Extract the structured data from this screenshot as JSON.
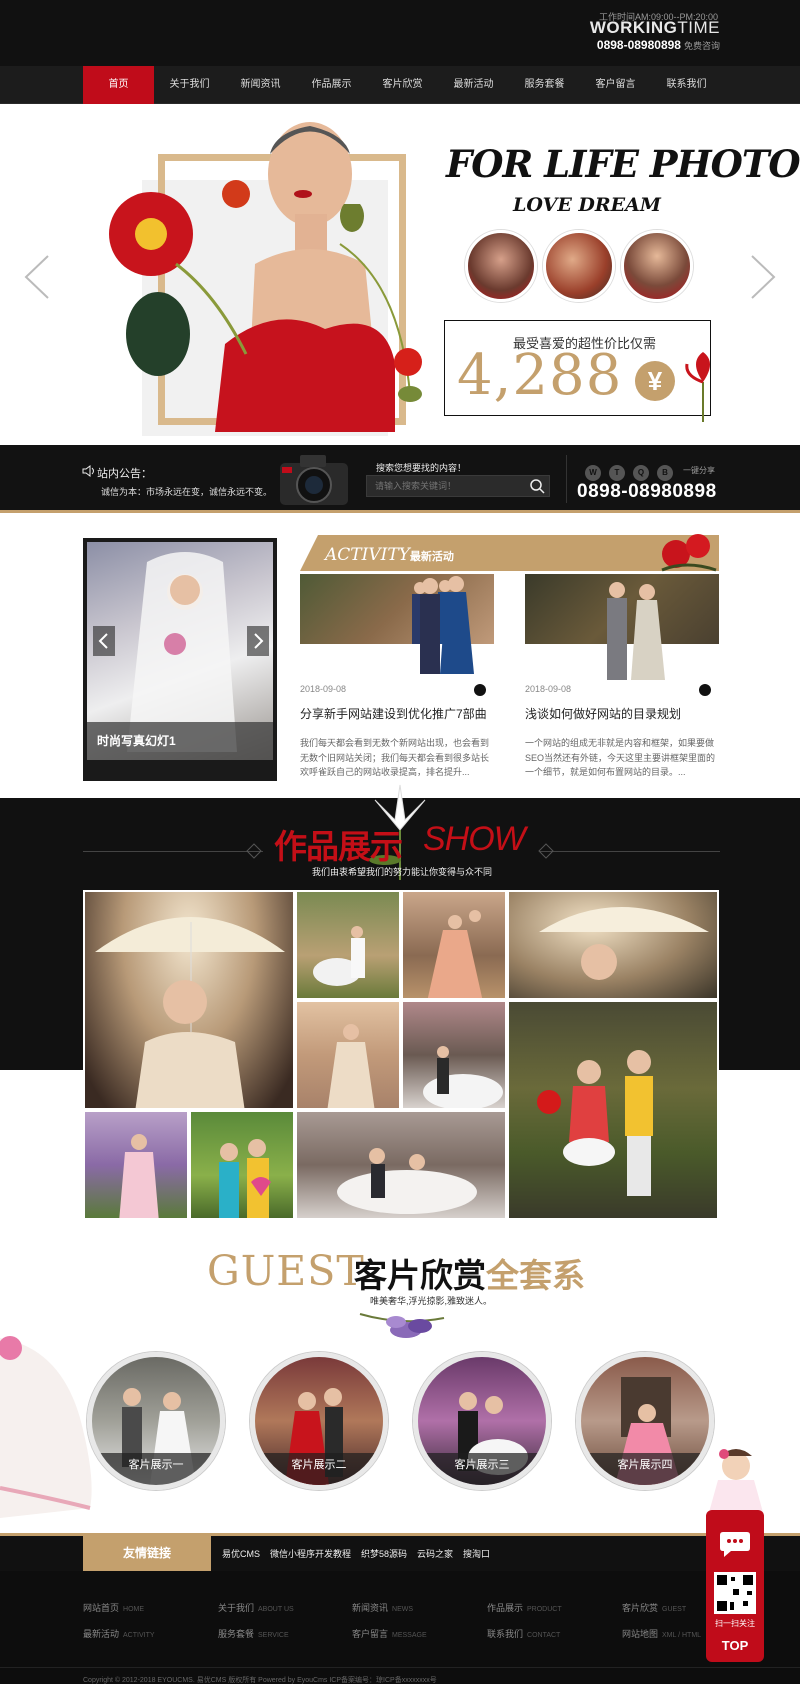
{
  "header": {
    "working_hours": "工作时间AM:09:00--PM:20:00",
    "working_title_bold": "WORKING",
    "working_title_rest": "TIME",
    "phone": "0898-08980898",
    "phone_note": "免费咨询"
  },
  "nav": {
    "items": [
      "首页",
      "关于我们",
      "新闻资讯",
      "作品展示",
      "客片欣赏",
      "最新活动",
      "服务套餐",
      "客户留言",
      "联系我们"
    ],
    "active": 0
  },
  "banner": {
    "headline": "FOR LIFE PHOTO",
    "subheadline": "LOVE DREAM",
    "price_caption": "最受喜爱的超性价比仅需",
    "price": "4,288",
    "currency": "¥"
  },
  "search_bar": {
    "notice_title": "站内公告：",
    "notice_text": "诚信为本：市场永远在变，诚信永远不变。",
    "search_title": "搜索您想要找的内容！",
    "search_placeholder": "请输入搜索关键词！",
    "share_label": "一键分享",
    "phone": "0898-08980898"
  },
  "slideshow": {
    "caption": "时尚写真幻灯1"
  },
  "activity": {
    "title_en": "ACTIVITY",
    "title_cn": "最新活动",
    "articles": [
      {
        "date": "2018-09-08",
        "title": "分享新手网站建设到优化推广7部曲",
        "desc": "我们每天都会看到无数个新网站出现，也会看到无数个旧网站关闭；我们每天都会看到很多站长欢呼雀跃自己的网站收录提高，排名提升..."
      },
      {
        "date": "2018-09-08",
        "title": "浅谈如何做好网站的目录规划",
        "desc": "一个网站的组成无非就是内容和框架，如果要做SEO当然还有外链，今天这里主要讲框架里面的一个细节，就是如何布置网站的目录。..."
      }
    ]
  },
  "works": {
    "title_cn": "作品展示",
    "title_en": "SHOW",
    "subtitle": "我们由衷希望我们的努力能让你变得与众不同"
  },
  "guest": {
    "title_en": "GUEST",
    "title_cn": "客片欣赏",
    "title_cn2": "全套系",
    "subtitle": "唯美奢华,浮光掠影,雅致迷人。",
    "items": [
      "客片展示一",
      "客片展示二",
      "客片展示三",
      "客片展示四"
    ]
  },
  "friend_links": {
    "title": "友情链接",
    "items": [
      "易优CMS",
      "微信小程序开发教程",
      "织梦58源码",
      "云码之家",
      "搜淘口"
    ]
  },
  "footer": {
    "links": [
      {
        "cn": "网站首页",
        "en": "HOME"
      },
      {
        "cn": "关于我们",
        "en": "ABOUT US"
      },
      {
        "cn": "新闻资讯",
        "en": "NEWS"
      },
      {
        "cn": "作品展示",
        "en": "PRODUCT"
      },
      {
        "cn": "客片欣赏",
        "en": "GUEST"
      },
      {
        "cn": "最新活动",
        "en": "ACTIVITY"
      },
      {
        "cn": "服务套餐",
        "en": "SERVICE"
      },
      {
        "cn": "客户留言",
        "en": "MESSAGE"
      },
      {
        "cn": "联系我们",
        "en": "CONTACT"
      },
      {
        "cn": "网站地图",
        "en": "XML / HTML"
      }
    ],
    "copyright": "Copyright © 2012-2018 EYOUCMS. 易优CMS 版权所有 Powered by EyouCms     ICP备案编号：琼ICP备xxxxxxxx号"
  },
  "float_qr": {
    "caption": "扫一扫关注",
    "top_label": "TOP"
  },
  "colors": {
    "accent_red": "#c00c1a",
    "gold": "#c4a06d",
    "dark": "#111111"
  }
}
